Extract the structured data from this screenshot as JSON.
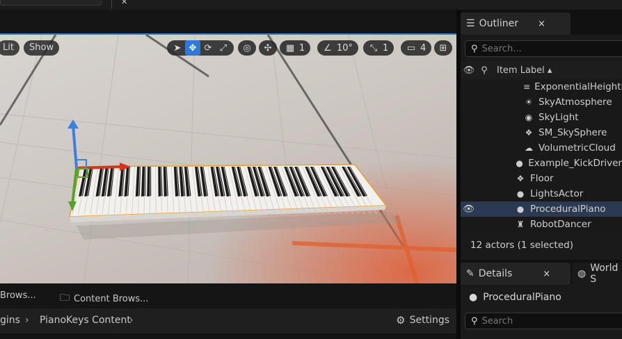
{
  "viewport": {
    "view_mode": "Lit",
    "show_label": "Show",
    "grid_snap": "1",
    "rotation_snap": "10°",
    "scale_snap": "1",
    "camera_speed": "4"
  },
  "drawer": {
    "tab1": "Brows...",
    "tab2": "Content Brows..."
  },
  "path": {
    "crumb1": "gins",
    "crumb2": "PianoKeys Content",
    "settings_label": "Settings"
  },
  "outliner": {
    "tab_label": "Outliner",
    "close": "×",
    "search_placeholder": "Search...",
    "column_label": "Item Label ▴",
    "items": [
      {
        "label": "ExponentialHeightF"
      },
      {
        "label": "SkyAtmosphere"
      },
      {
        "label": "SkyLight"
      },
      {
        "label": "SM_SkySphere"
      },
      {
        "label": "VolumetricCloud"
      },
      {
        "label": "Example_KickDriver"
      },
      {
        "label": "Floor"
      },
      {
        "label": "LightsActor"
      },
      {
        "label": "ProceduralPiano"
      },
      {
        "label": "RobotDancer"
      }
    ],
    "status": "12 actors (1 selected)"
  },
  "details": {
    "tab_label": "Details",
    "close": "×",
    "world_tab_label": "World S",
    "selected_name": "ProceduralPiano",
    "search_placeholder": "Search"
  },
  "colors": {
    "accent": "#2f7ad6",
    "selection": "#2b3a52",
    "axis_x": "#d4361c",
    "axis_y": "#5aa02c",
    "axis_z": "#3f7fdc",
    "selection_outline": "#e8a030"
  }
}
